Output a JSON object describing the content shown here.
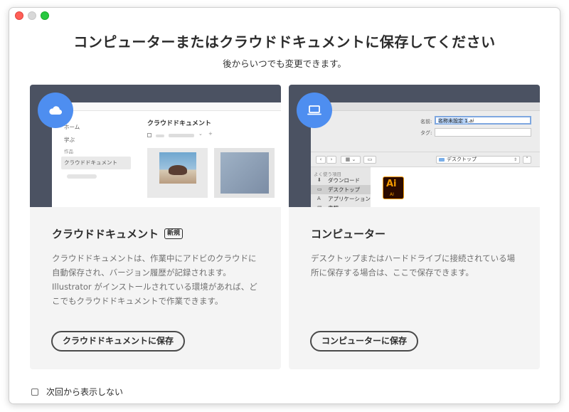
{
  "dialog": {
    "title": "コンピューターまたはクラウドドキュメントに保存してください",
    "subtitle": "後からいつでも変更できます。"
  },
  "cloud_card": {
    "icon": "cloud-icon",
    "preview": {
      "sidebar_items": [
        "ホーム",
        "学ぶ",
        "作品",
        "クラウドドキュメント"
      ],
      "heading": "クラウドドキュメント"
    },
    "title": "クラウドドキュメント",
    "badge": "新規",
    "description": "クラウドドキュメントは、作業中にアドビのクラウドに自動保存され、バージョン履歴が記録されます。Illustrator がインストールされている環境があれば、どこでもクラウドドキュメントで作業できます。",
    "button_label": "クラウドドキュメントに保存"
  },
  "computer_card": {
    "icon": "laptop-icon",
    "preview": {
      "name_label": "名前:",
      "name_value": "名称未設定 1",
      "name_ext": ".ai",
      "tag_label": "タグ:",
      "location": "デスクトップ",
      "favorites_title": "よく使う項目",
      "favorites": [
        "ダウンロード",
        "デスクトップ",
        "アプリケーション",
        "書類"
      ],
      "file_icon_big": "Ai",
      "file_icon_small": "AI"
    },
    "title": "コンピューター",
    "description": "デスクトップまたはハードドライブに接続されている場所に保存する場合は、ここで保存できます。",
    "button_label": "コンピューターに保存"
  },
  "footer": {
    "checkbox_label": "次回から表示しない",
    "checked": false
  },
  "colors": {
    "accent": "#4e8ef0",
    "preview_bg": "#4b5262",
    "card_bg": "#f4f4f4"
  }
}
